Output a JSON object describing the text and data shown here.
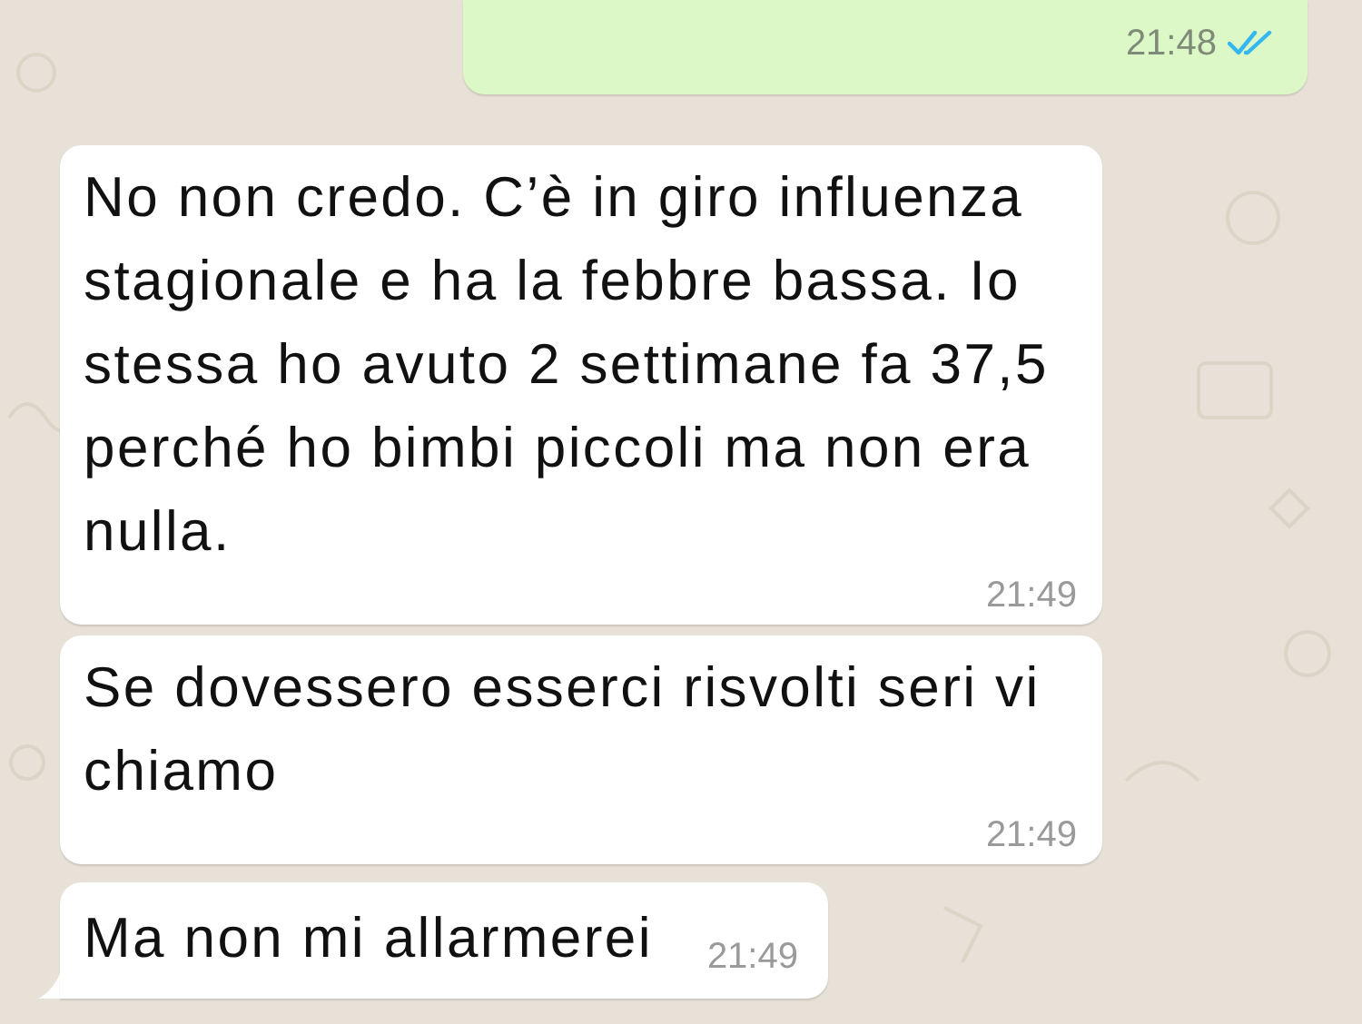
{
  "messages": [
    {
      "kind": "out",
      "time": "21:48",
      "read": true
    },
    {
      "kind": "in",
      "text": "No non credo. C’è in giro influenza stagionale e ha la febbre bassa. Io stessa ho avuto 2 settimane fa 37,5 perché ho bimbi piccoli ma non era nulla.",
      "time": "21:49",
      "tail": false
    },
    {
      "kind": "in",
      "text": "Se dovessero esserci risvolti seri vi chiamo",
      "time": "21:49",
      "tail": false
    },
    {
      "kind": "in",
      "text": "Ma non mi allarmerei",
      "time": "21:49",
      "tail": true
    }
  ]
}
